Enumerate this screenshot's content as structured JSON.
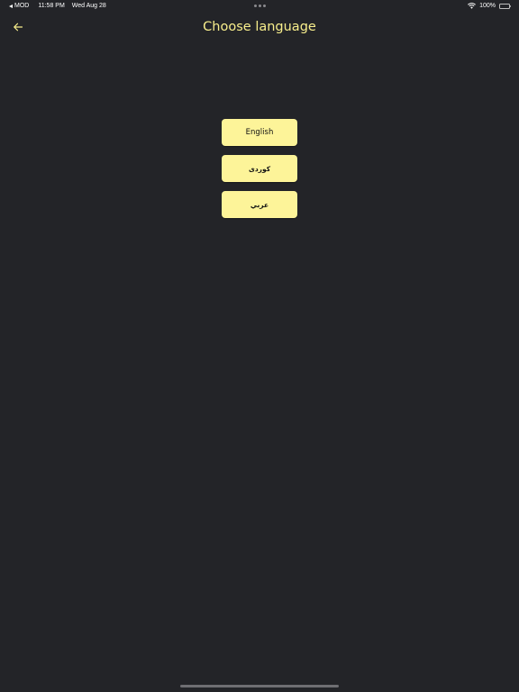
{
  "status_bar": {
    "back_app": "MOD",
    "time": "11:58 PM",
    "date": "Wed Aug 28",
    "battery": "100%",
    "battery_level": 1.0,
    "icons": [
      "back-arrow-icon",
      "multitasking-dots-icon",
      "wifi-icon",
      "battery-icon"
    ]
  },
  "header": {
    "title": "Choose language",
    "back_icon": "arrow-left-icon"
  },
  "languages": [
    {
      "label": "English"
    },
    {
      "label": "کوردی"
    },
    {
      "label": "عربي"
    }
  ],
  "colors": {
    "background": "#232428",
    "accent": "#f8ee8c",
    "button_bg": "#fdf499",
    "button_text": "#111111"
  }
}
